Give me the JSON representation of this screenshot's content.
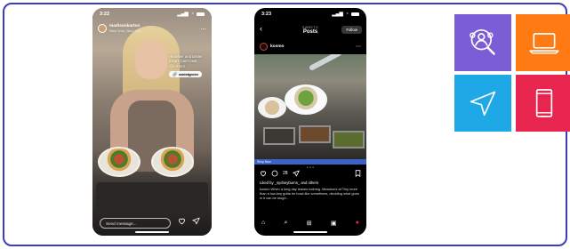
{
  "phone_left": {
    "status_time": "3:22",
    "username": "madisonkarton",
    "location": "New York, New York",
    "overlay_text": "Healthier and tastier meal? Can't beat @kosmo!",
    "overlay_link": "sweetgreen",
    "message_placeholder": "Send message..."
  },
  "phone_right": {
    "status_time": "3:23",
    "nav_subtitle": "SWEETG",
    "nav_title": "Posts",
    "follow_label": "Follow",
    "username": "kosmo",
    "shop_label": "Shop Now",
    "comment_count": "28",
    "liked_text": "Liked by _sydneyburns_ and others",
    "caption": "kosmo When a long day leaves nothing. Meadow's at Tiny more than a low-key gotta be bowl-like sometimes, deciding what goes in it can be tough..."
  },
  "tiles": [
    {
      "name": "research",
      "color": "#7b5ed6",
      "icon": "user-search-icon"
    },
    {
      "name": "laptop",
      "color": "#ff7a12",
      "icon": "laptop-icon"
    },
    {
      "name": "send",
      "color": "#1fa8e6",
      "icon": "send-icon"
    },
    {
      "name": "mobile",
      "color": "#e8254f",
      "icon": "smartphone-icon"
    }
  ]
}
